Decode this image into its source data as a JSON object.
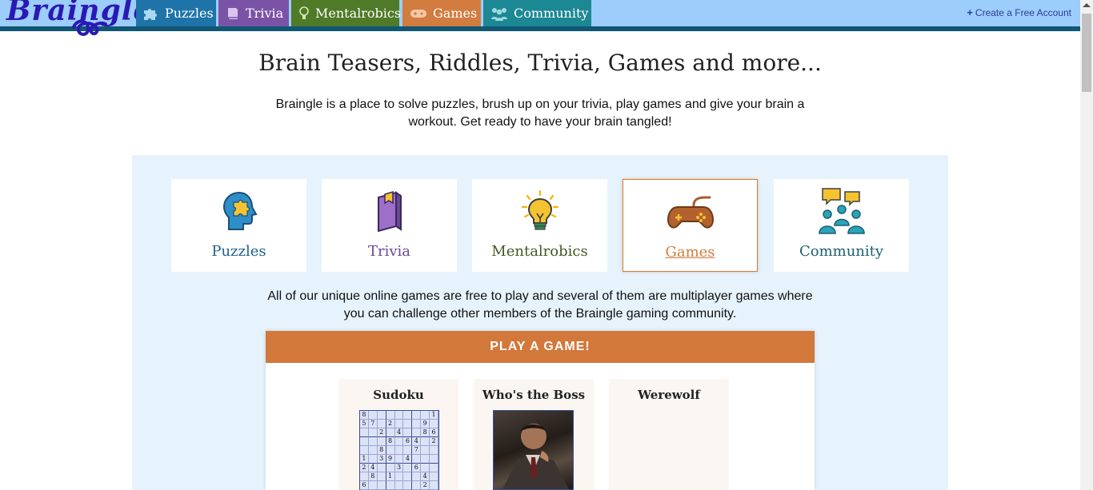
{
  "header": {
    "logo_text": "Braingle",
    "nav": [
      {
        "label": "Puzzles",
        "icon": "puzzle-piece-icon",
        "color": "#1e74a8"
      },
      {
        "label": "Trivia",
        "icon": "book-icon",
        "color": "#7b53a6"
      },
      {
        "label": "Mentalrobics",
        "icon": "lightbulb-icon",
        "color": "#4f7a28"
      },
      {
        "label": "Games",
        "icon": "gamepad-icon",
        "color": "#d27c3f"
      },
      {
        "label": "Community",
        "icon": "users-icon",
        "color": "#1c8893"
      }
    ],
    "create_account": "Create a Free Account"
  },
  "hero": {
    "title": "Brain Teasers, Riddles, Trivia, Games and more...",
    "intro": "Braingle is a place to solve puzzles, brush up on your trivia, play games and give your brain a workout. Get ready to have your brain tangled!"
  },
  "categories": [
    {
      "label": "Puzzles",
      "icon": "head-puzzle-icon",
      "color": "#1e5f8f"
    },
    {
      "label": "Trivia",
      "icon": "book-icon",
      "color": "#6b4a94"
    },
    {
      "label": "Mentalrobics",
      "icon": "lightbulb-icon",
      "color": "#3f5a23"
    },
    {
      "label": "Games",
      "icon": "game-controller-icon",
      "color": "#d27c3f",
      "active": true
    },
    {
      "label": "Community",
      "icon": "community-chat-icon",
      "color": "#1b5f70"
    }
  ],
  "games_section": {
    "description": "All of our unique online games are free to play and several of them are multiplayer games where you can challenge other members of the Braingle gaming community.",
    "play_header": "PLAY A GAME!",
    "games": [
      {
        "name": "Sudoku",
        "sudoku_grid": [
          [
            "8",
            "",
            "",
            "",
            "",
            "",
            "",
            "",
            "1"
          ],
          [
            "5",
            "7",
            "",
            "2",
            "",
            "",
            "",
            "9",
            ""
          ],
          [
            "",
            "",
            "2",
            "",
            "4",
            "",
            "",
            "8",
            "6"
          ],
          [
            "",
            "",
            "",
            "8",
            "",
            "6",
            "4",
            "",
            "2"
          ],
          [
            "",
            "",
            "8",
            "",
            "",
            "",
            "7",
            "",
            ""
          ],
          [
            "1",
            "",
            "3",
            "9",
            "",
            "4",
            "",
            "",
            ""
          ],
          [
            "2",
            "4",
            "",
            "",
            "3",
            "",
            "6",
            "",
            ""
          ],
          [
            "",
            "8",
            "",
            "1",
            "",
            "",
            "",
            "4",
            ""
          ],
          [
            "6",
            "",
            "",
            "",
            "",
            "",
            "",
            "2",
            ""
          ]
        ]
      },
      {
        "name": "Who's the Boss"
      },
      {
        "name": "Werewolf"
      }
    ]
  }
}
